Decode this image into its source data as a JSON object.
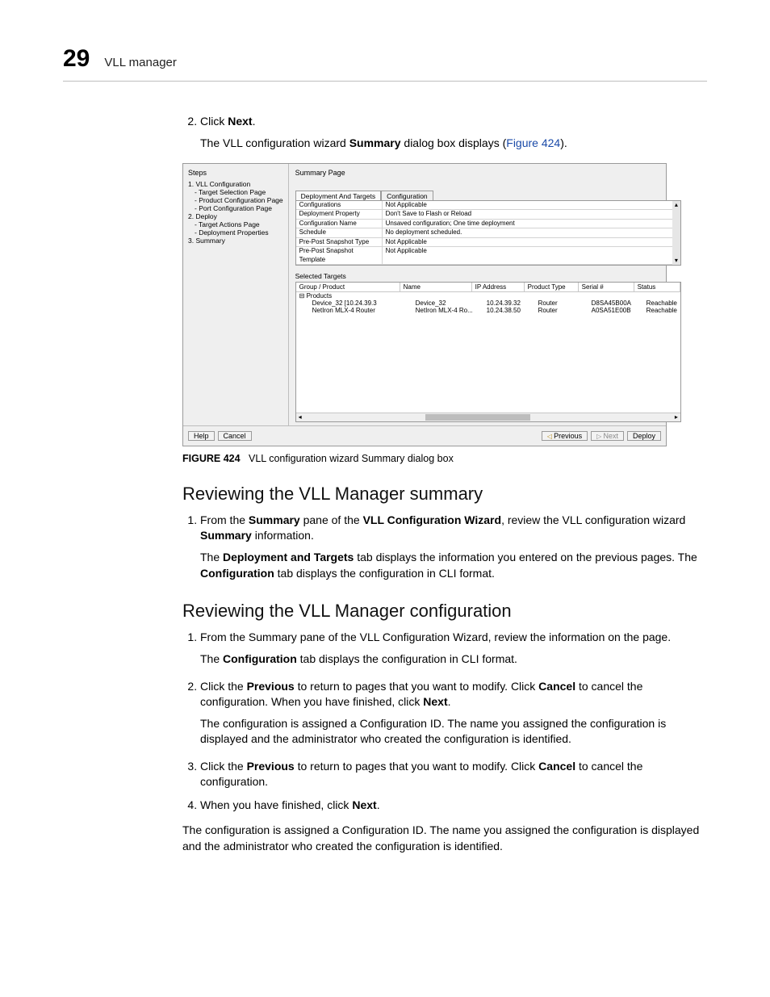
{
  "header": {
    "chapter_number": "29",
    "chapter_title": "VLL manager"
  },
  "intro": {
    "step_num": "2.",
    "click": "Click ",
    "next_bold": "Next",
    "period": ".",
    "line2_a": "The VLL configuration wizard ",
    "line2_b": "Summary",
    "line2_c": " dialog box displays (",
    "figure_link": "Figure 424",
    "line2_end": ")."
  },
  "figure": {
    "steps_header": "Steps",
    "main_header": "Summary Page",
    "steps": [
      "1. VLL Configuration",
      "- Target Selection Page",
      "- Product Configuration Page",
      "- Port Configuration Page",
      "2. Deploy",
      "- Target Actions Page",
      "- Deployment Properties",
      "3. Summary"
    ],
    "tabs": {
      "active": "Deployment And Targets",
      "inactive": "Configuration"
    },
    "kv": [
      {
        "k": "Configurations",
        "v": "Not Applicable"
      },
      {
        "k": "Deployment Property",
        "v": "Don't Save to Flash or Reload"
      },
      {
        "k": "Configuration Name",
        "v": "Unsaved configuration; One time deployment"
      },
      {
        "k": "Schedule",
        "v": "No deployment scheduled."
      },
      {
        "k": "Pre-Post Snapshot Type",
        "v": "Not Applicable"
      },
      {
        "k": "Pre-Post Snapshot Template",
        "v": "Not Applicable"
      }
    ],
    "selected_targets_label": "Selected Targets",
    "columns": {
      "group": "Group / Product",
      "name": "Name",
      "ip": "IP Address",
      "ptype": "Product Type",
      "serial": "Serial #",
      "status": "Status"
    },
    "rows": [
      {
        "group": "Products",
        "name": "",
        "ip": "",
        "ptype": "",
        "serial": "",
        "status": "",
        "lvl": 0
      },
      {
        "group": "Device_32 [10.24.39.3",
        "name": "Device_32",
        "ip": "10.24.39.32",
        "ptype": "Router",
        "serial": "D8SA45B00A",
        "status": "Reachable",
        "lvl": 1
      },
      {
        "group": "NetIron MLX-4 Router",
        "name": "NetIron MLX-4 Ro...",
        "ip": "10.24.38.50",
        "ptype": "Router",
        "serial": "A0SA51E00B",
        "status": "Reachable",
        "lvl": 1
      }
    ],
    "buttons": {
      "help": "Help",
      "cancel": "Cancel",
      "previous": "Previous",
      "next": "Next",
      "deploy": "Deploy"
    },
    "scroll": {
      "up": "▴",
      "down": "▾",
      "left": "◂",
      "right": "▸"
    }
  },
  "caption": {
    "label": "FIGURE 424",
    "text": "VLL configuration wizard Summary dialog box"
  },
  "section1": {
    "title": "Reviewing the VLL Manager summary",
    "item1_a": "From the ",
    "item1_b": "Summary",
    "item1_c": " pane of the ",
    "item1_d": "VLL Configuration Wizard",
    "item1_e": ", review the VLL configuration wizard ",
    "item1_f": "Summary",
    "item1_g": " information.",
    "para_a": "The ",
    "para_b": "Deployment and Targets",
    "para_c": " tab displays the information you entered on the previous pages. The ",
    "para_d": "Configuration",
    "para_e": " tab displays the configuration in CLI format."
  },
  "section2": {
    "title": "Reviewing the VLL Manager configuration",
    "item1": "From the Summary pane of the VLL Configuration Wizard, review the information on the page.",
    "item1_after_a": "The ",
    "item1_after_b": "Configuration",
    "item1_after_c": " tab displays the configuration in CLI format.",
    "item2_a": "Click the ",
    "item2_b": "Previous",
    "item2_c": " to return to pages that you want to modify. Click ",
    "item2_d": "Cancel",
    "item2_e": " to cancel the configuration. When you have finished, click ",
    "item2_f": "Next",
    "item2_g": ".",
    "item2_after": "The configuration is assigned a Configuration ID. The name you assigned the configuration is displayed and the administrator who created the configuration is identified.",
    "item3_a": "Click the ",
    "item3_b": "Previous",
    "item3_c": " to return to pages that you want to modify. Click ",
    "item3_d": "Cancel",
    "item3_e": " to cancel the configuration.",
    "item4_a": "When you have finished, click ",
    "item4_b": "Next",
    "item4_c": ".",
    "trailer": "The configuration is assigned a Configuration ID. The name you assigned the configuration is displayed and the administrator who created the configuration is identified."
  }
}
